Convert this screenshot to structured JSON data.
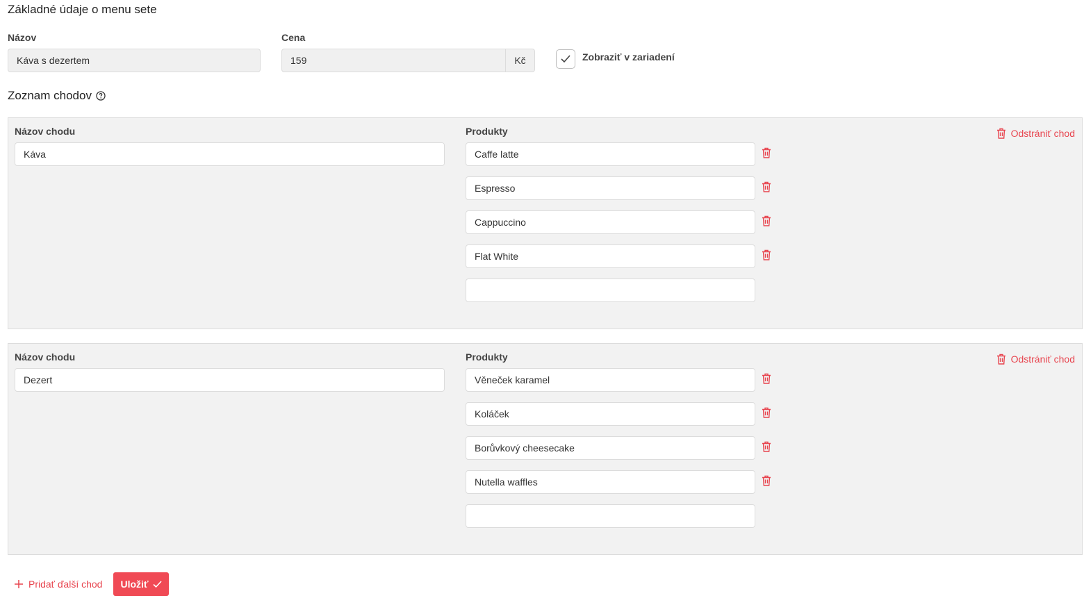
{
  "header": {
    "title": "Základné údaje o menu sete"
  },
  "basic": {
    "name_label": "Názov",
    "name_value": "Káva s dezertem",
    "price_label": "Cena",
    "price_value": "159",
    "currency": "Kč",
    "display_checked": true,
    "display_label": "Zobraziť v zariadení"
  },
  "courses_title": "Zoznam chodov",
  "courses": [
    {
      "name_label": "Názov chodu",
      "name_value": "Káva",
      "products_label": "Produkty",
      "products": [
        "Caffe latte",
        "Espresso",
        "Cappuccino",
        "Flat White"
      ],
      "empty_product": "",
      "remove_label": "Odstrániť chod"
    },
    {
      "name_label": "Názov chodu",
      "name_value": "Dezert",
      "products_label": "Produkty",
      "products": [
        "Věneček karamel",
        "Koláček",
        "Borůvkový cheesecake",
        "Nutella waffles"
      ],
      "empty_product": "",
      "remove_label": "Odstrániť chod"
    }
  ],
  "actions": {
    "add_course_label": "Pridať ďalší chod",
    "save_label": "Uložiť"
  },
  "colors": {
    "accent": "#f04a55",
    "danger_text": "#e8454f",
    "panel_bg": "#f2f2f2",
    "field_bg_disabled": "#f0f0f0"
  }
}
